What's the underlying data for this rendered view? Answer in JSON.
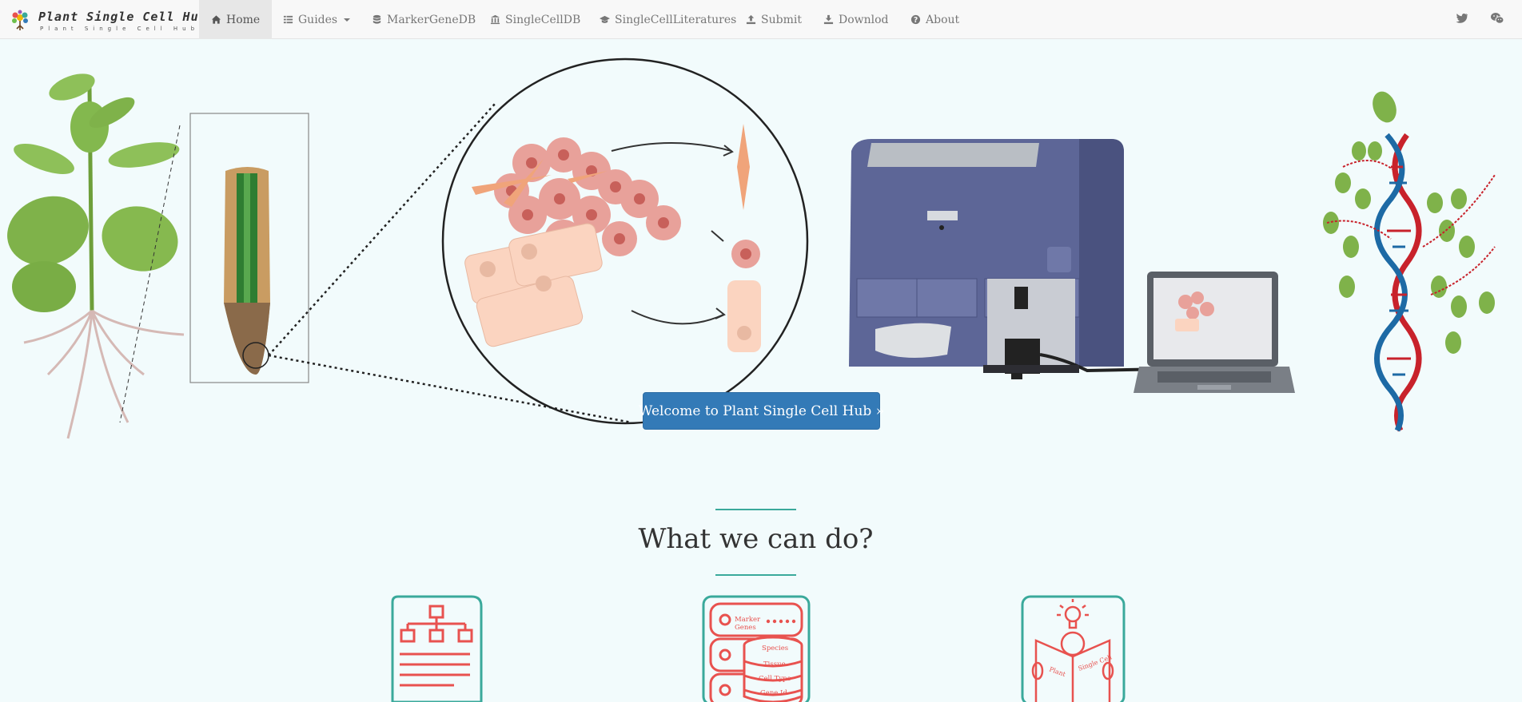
{
  "brand": {
    "title": "Plant Single Cell Hub",
    "subtitle": "Plant Single Cell Hub"
  },
  "nav": {
    "items": [
      {
        "label": "Home",
        "icon": "home-icon"
      },
      {
        "label": "Guides",
        "icon": "list-icon"
      },
      {
        "label": "MarkerGeneDB",
        "icon": "database-icon"
      },
      {
        "label": "SingleCellDB",
        "icon": "bank-icon"
      },
      {
        "label": "SingleCellLiteratures",
        "icon": "graduation-cap-icon"
      },
      {
        "label": "Submit",
        "icon": "upload-icon"
      },
      {
        "label": "Downlod",
        "icon": "download-icon"
      },
      {
        "label": "About",
        "icon": "question-circle-icon"
      }
    ],
    "social": [
      "twitter-icon",
      "wechat-icon"
    ]
  },
  "hero": {
    "button_label": "Welcome to Plant Single Cell Hub »"
  },
  "section": {
    "title": "What we can do?"
  },
  "features": {
    "database_labels": [
      "Marker Genes",
      "Species",
      "Tissue",
      "Cell Type",
      "Gene Id"
    ],
    "book_labels": [
      "Plant",
      "Single Cell"
    ]
  },
  "colors": {
    "accent_teal": "#3aa99b",
    "icon_red": "#e8524f",
    "button_blue": "#337ab7",
    "page_bg": "#f2fbfc"
  }
}
